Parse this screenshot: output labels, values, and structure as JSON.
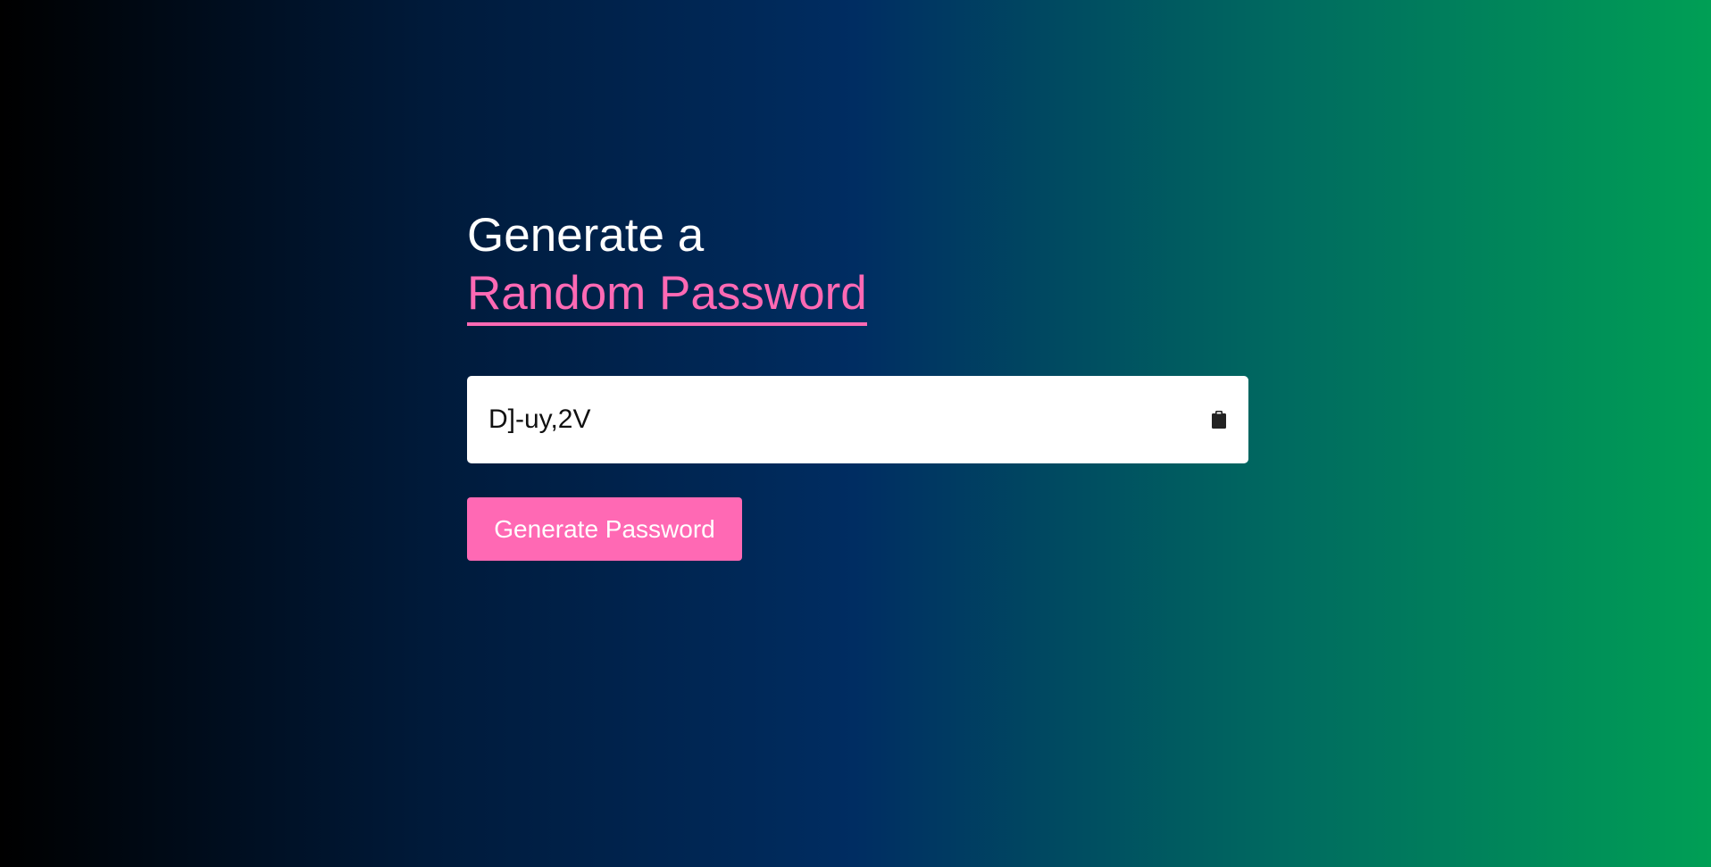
{
  "heading": {
    "line1": "Generate a",
    "line2": "Random Password"
  },
  "password": {
    "value": "D]-uy,2V"
  },
  "copy": {
    "icon": "clipboard-icon"
  },
  "actions": {
    "generate_label": "Generate Password"
  },
  "colors": {
    "accent": "#ff69b4",
    "background_start": "#000000",
    "background_mid": "#002d62",
    "background_end": "#009f55"
  }
}
